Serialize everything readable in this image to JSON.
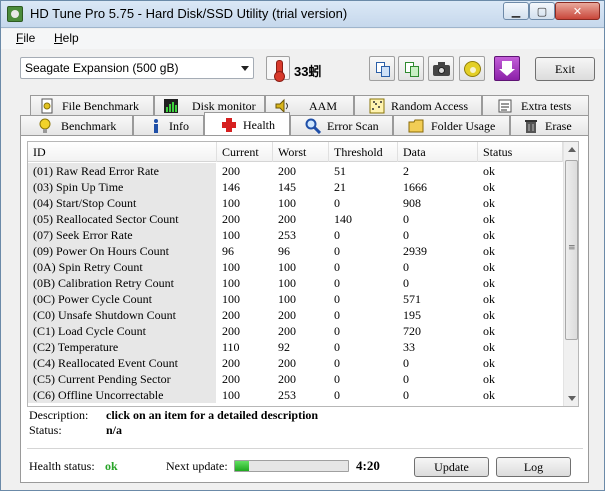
{
  "window": {
    "title": "HD Tune Pro 5.75 - Hard Disk/SSD Utility (trial version)"
  },
  "menu": {
    "file": "File",
    "help": "Help"
  },
  "toolbar": {
    "drive": "Seagate Expansion (500 gB)",
    "temperature": "33蚓",
    "exit_label": "Exit",
    "icons": [
      "thermometer-icon",
      "copy-text-icon",
      "copy-screen-icon",
      "screenshot-icon",
      "options-icon",
      "save-icon"
    ]
  },
  "tabs_top": [
    "File Benchmark",
    "Disk monitor",
    "AAM",
    "Random Access",
    "Extra tests"
  ],
  "tabs_bottom": [
    "Benchmark",
    "Info",
    "Health",
    "Error Scan",
    "Folder Usage",
    "Erase"
  ],
  "active_tab": "Health",
  "table": {
    "columns": [
      "ID",
      "Current",
      "Worst",
      "Threshold",
      "Data",
      "Status"
    ],
    "rows": [
      [
        "(01) Raw Read Error Rate",
        "200",
        "200",
        "51",
        "2",
        "ok"
      ],
      [
        "(03) Spin Up Time",
        "146",
        "145",
        "21",
        "1666",
        "ok"
      ],
      [
        "(04) Start/Stop Count",
        "100",
        "100",
        "0",
        "908",
        "ok"
      ],
      [
        "(05) Reallocated Sector Count",
        "200",
        "200",
        "140",
        "0",
        "ok"
      ],
      [
        "(07) Seek Error Rate",
        "100",
        "253",
        "0",
        "0",
        "ok"
      ],
      [
        "(09) Power On Hours Count",
        "96",
        "96",
        "0",
        "2939",
        "ok"
      ],
      [
        "(0A) Spin Retry Count",
        "100",
        "100",
        "0",
        "0",
        "ok"
      ],
      [
        "(0B) Calibration Retry Count",
        "100",
        "100",
        "0",
        "0",
        "ok"
      ],
      [
        "(0C) Power Cycle Count",
        "100",
        "100",
        "0",
        "571",
        "ok"
      ],
      [
        "(C0) Unsafe Shutdown Count",
        "200",
        "200",
        "0",
        "195",
        "ok"
      ],
      [
        "(C1) Load Cycle Count",
        "200",
        "200",
        "0",
        "720",
        "ok"
      ],
      [
        "(C2) Temperature",
        "110",
        "92",
        "0",
        "33",
        "ok"
      ],
      [
        "(C4) Reallocated Event Count",
        "200",
        "200",
        "0",
        "0",
        "ok"
      ],
      [
        "(C5) Current Pending Sector",
        "200",
        "200",
        "0",
        "0",
        "ok"
      ],
      [
        "(C6) Offline Uncorrectable",
        "100",
        "253",
        "0",
        "0",
        "ok"
      ]
    ]
  },
  "details": {
    "description_label": "Description:",
    "description_value": "click on an item for a detailed description",
    "status_label": "Status:",
    "status_value": "n/a"
  },
  "footer": {
    "health_label": "Health status:",
    "health_value": "ok",
    "next_update_label": "Next update:",
    "countdown": "4:20",
    "progress_fraction": 0.12,
    "update_label": "Update",
    "log_label": "Log"
  }
}
